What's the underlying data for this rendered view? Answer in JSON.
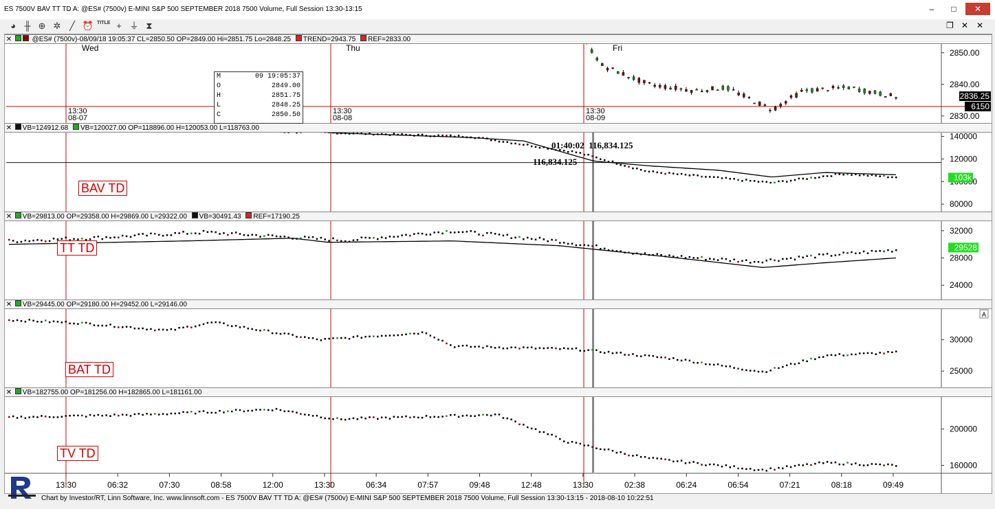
{
  "window": {
    "title": "ES 7500V BAV TT TD A: @ES# (7500v) E-MINI S&P 500 SEPTEMBER 2018 7500 Volume, Full Session 13:30-13:15",
    "min": "–",
    "max": "□",
    "close": "✕"
  },
  "toolbar": {
    "title_tool": "TITLE"
  },
  "panes": {
    "price": {
      "header": "@ES# (7500v)-08/09/18 19:05:37 CL=2850.50 OP=2849.00 Hi=2851.75 Lo=2848.25",
      "trend": "TREND=2943.75",
      "ref": "REF=2833.00",
      "last_price": "2836.25",
      "last_vol": "6150",
      "ticks": [
        "2850.00",
        "2840.00",
        "2830.00"
      ],
      "days": [
        "Wed",
        "Thu",
        "Fri"
      ],
      "session_marks": [
        {
          "time": "13:30",
          "date": "08-07"
        },
        {
          "time": "13:30",
          "date": "08-08"
        },
        {
          "time": "13:30",
          "date": "08-09"
        }
      ],
      "ohlc": {
        "M": "09 19:05:37",
        "O": "2849.00",
        "H": "2851.75",
        "L": "2848.25",
        "C": "2850.50"
      }
    },
    "bav": {
      "header1": "VB=124912.68",
      "header2": "VB=120027.00 OP=118896.00 H=120053.00 L=118763.00",
      "label": "BAV TD",
      "last": "103k",
      "ticks": [
        "140000",
        "120000",
        "100000",
        "80000"
      ],
      "cross_time": "01:40:02",
      "cross_value": "116,834.125",
      "cross_value_2": "116,834.125"
    },
    "tt": {
      "header1": "VB=29813.00 OP=29358.00 H=29869.00 L=29322.00",
      "header2": "VB=30491.43",
      "header3": "REF=17190.25",
      "label": "TT TD",
      "last": "29528",
      "ticks": [
        "32000",
        "28000",
        "24000"
      ]
    },
    "bat": {
      "header": "VB=29445.00 OP=29180.00 H=29452.00 L=29146.00",
      "label": "BAT TD",
      "ticks": [
        "30000",
        "25000"
      ],
      "corner": "A"
    },
    "tv": {
      "header": "VB=182755.00 OP=181256.00 H=182865.00 L=181161.00",
      "label": "TV TD",
      "ticks": [
        "200000",
        "160000"
      ]
    }
  },
  "xaxis": [
    "13:30",
    "06:32",
    "07:30",
    "08:58",
    "12:00",
    "13:30",
    "06:34",
    "07:57",
    "09:48",
    "12:48",
    "13:30",
    "02:38",
    "06:24",
    "06:54",
    "07:21",
    "08:18",
    "09:49"
  ],
  "footer": "Chart by Investor/RT, Linn Software, Inc. www.linnsoft.com - ES 7500V BAV TT TD A: @ES# (7500v) E-MINI S&P 500 SEPTEMBER 2018 7500 Volume, Full Session 13:30-13:15 - 2018-08-10 10:22:51",
  "chart_data": {
    "type": "line",
    "x_labels": [
      "13:30",
      "06:32",
      "07:30",
      "08:58",
      "12:00",
      "13:30",
      "06:34",
      "07:57",
      "09:48",
      "12:48",
      "13:30",
      "02:38",
      "06:24",
      "06:54",
      "07:21",
      "08:18",
      "09:49"
    ],
    "panels": [
      {
        "name": "price",
        "ylim": [
          2828,
          2853
        ],
        "ticks": [
          2850,
          2840,
          2830
        ],
        "ref": 2833.0,
        "last": 2836.25
      },
      {
        "name": "BAV TD",
        "ylim": [
          74000,
          144000
        ],
        "ticks": [
          140000,
          120000,
          100000,
          80000
        ],
        "ref_line": 116834.125
      },
      {
        "name": "TT TD",
        "ylim": [
          22000,
          33500
        ],
        "ticks": [
          32000,
          28000,
          24000
        ]
      },
      {
        "name": "BAT TD",
        "ylim": [
          22500,
          35000
        ],
        "ticks": [
          30000,
          25000
        ]
      },
      {
        "name": "TV TD",
        "ylim": [
          152000,
          236000
        ],
        "ticks": [
          200000,
          160000
        ]
      }
    ],
    "colors": {
      "cursor": "#d00000",
      "last_price_bg": "#000000",
      "last_osc_bg": "#22dd22",
      "up_bar": "#228b22",
      "down_bar": "#8b0000"
    }
  }
}
